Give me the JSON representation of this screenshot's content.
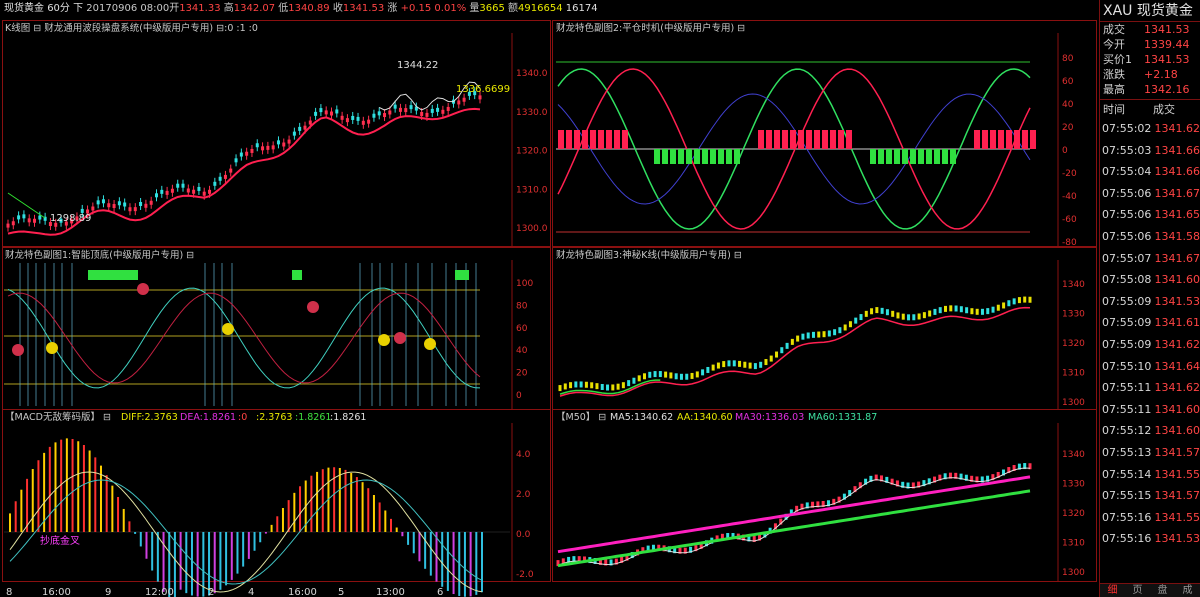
{
  "header": {
    "symbol": "现货黄金",
    "period": "60分",
    "mode": "下",
    "datetime": "20170906 08:00",
    "open_label": "开",
    "open": "1341.33",
    "high_label": "高",
    "high": "1342.07",
    "low_label": "低",
    "low": "1340.89",
    "close_label": "收",
    "close": "1341.53",
    "change_label": "涨",
    "change": "+0.15",
    "change_pct": "0.01%",
    "vol_label": "量",
    "vol": "3665",
    "amt_label": "额",
    "amt": "4916654",
    "extra": "16174"
  },
  "panels": {
    "kline": {
      "title": "K线图 ⊟ 财龙通用波段操盘系统(中级版用户专用) ⊟:0 :1 :0",
      "annot_high": "1344.22",
      "annot_low": "1298.89",
      "annot_last": "1336.6699",
      "yticks": [
        "1340.0",
        "1330.0",
        "1320.0",
        "1310.0",
        "1300.0"
      ]
    },
    "timing": {
      "title": "财龙特色副图2:平仓时机(中级版用户专用) ⊟",
      "yticks": [
        "80",
        "60",
        "40",
        "20",
        "0",
        "-20",
        "-40",
        "-60",
        "-80"
      ]
    },
    "topbottom": {
      "title": "财龙特色副图1:智能顶底(中级版用户专用) ⊟",
      "yticks": [
        "100",
        "80",
        "60",
        "40",
        "20",
        "0"
      ]
    },
    "mystic": {
      "title": "财龙特色副图3:神秘K线(中级版用户专用) ⊟",
      "yticks": [
        "1340",
        "1330",
        "1320",
        "1310",
        "1300"
      ]
    },
    "macd": {
      "title": "【MACD无敌筹码版】 ⊟",
      "diff": "DIFF:2.3763",
      "dea": "DEA:1.8261",
      "m1": ":0",
      "m2": ":2.3763",
      "m3": ":1.8261",
      "m4": ":1.8261",
      "label": "抄底金叉",
      "yticks": [
        "4.0",
        "2.0",
        "0.0",
        "-2.0"
      ]
    },
    "ma": {
      "title": "【M50】 ⊟",
      "ma5": "MA5:1340.62",
      "aa": "AA:1340.60",
      "ma30": "MA30:1336.03",
      "ma60": "MA60:1331.87",
      "yticks": [
        "1340",
        "1330",
        "1320",
        "1310",
        "1300"
      ]
    }
  },
  "xaxis": [
    "8",
    "16:00",
    "9",
    "12:00",
    "2",
    "4",
    "16:00",
    "5",
    "13:00",
    "6"
  ],
  "sidebar": {
    "code": "XAU",
    "name": "现货黄金",
    "quotes": [
      {
        "k": "成交",
        "v": "1341.53"
      },
      {
        "k": "今开",
        "v": "1339.44"
      },
      {
        "k": "买价1",
        "v": "1341.53"
      },
      {
        "k": "涨跌",
        "v": "+2.18"
      },
      {
        "k": "最高",
        "v": "1342.16"
      }
    ],
    "trade_head": [
      "时间",
      "成交"
    ],
    "trades": [
      {
        "t": "07:55:02",
        "p": "1341.62"
      },
      {
        "t": "07:55:03",
        "p": "1341.66"
      },
      {
        "t": "07:55:04",
        "p": "1341.66"
      },
      {
        "t": "07:55:06",
        "p": "1341.67"
      },
      {
        "t": "07:55:06",
        "p": "1341.65"
      },
      {
        "t": "07:55:06",
        "p": "1341.58"
      },
      {
        "t": "07:55:07",
        "p": "1341.67"
      },
      {
        "t": "07:55:08",
        "p": "1341.60"
      },
      {
        "t": "07:55:09",
        "p": "1341.53"
      },
      {
        "t": "07:55:09",
        "p": "1341.61"
      },
      {
        "t": "07:55:09",
        "p": "1341.62"
      },
      {
        "t": "07:55:10",
        "p": "1341.64"
      },
      {
        "t": "07:55:11",
        "p": "1341.62"
      },
      {
        "t": "07:55:11",
        "p": "1341.60"
      },
      {
        "t": "07:55:12",
        "p": "1341.60"
      },
      {
        "t": "07:55:13",
        "p": "1341.57"
      },
      {
        "t": "07:55:14",
        "p": "1341.55"
      },
      {
        "t": "07:55:15",
        "p": "1341.57"
      },
      {
        "t": "07:55:16",
        "p": "1341.55"
      },
      {
        "t": "07:55:16",
        "p": "1341.53"
      }
    ],
    "tabs": [
      "细",
      "页",
      "盘",
      "成"
    ]
  }
}
